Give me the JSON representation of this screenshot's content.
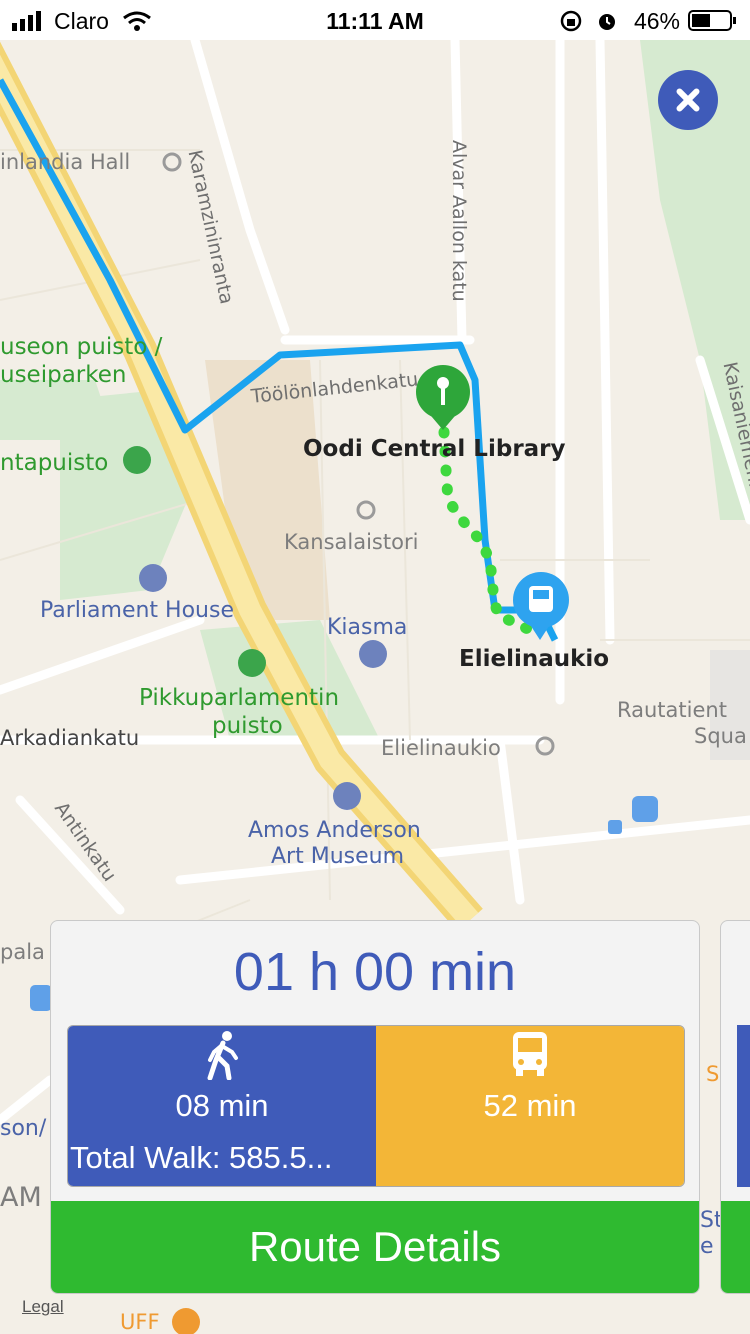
{
  "status_bar": {
    "carrier": "Claro",
    "time": "11:11 AM",
    "battery": "46%"
  },
  "map": {
    "labels": {
      "finlandia_hall": "inlandia Hall",
      "karamzininranta": "Karamzininranta",
      "alvar_aallon_katu": "Alvar Aallon katu",
      "toolonlahdenkatu": "Töölönlahdenkatu",
      "kaisaniemenkatu": "Kaisaniemenk",
      "museon_puisto": "useon puisto /",
      "museiparken": "useiparken",
      "tantapuisto": "ntapuisto",
      "oodi": "Oodi Central Library",
      "kansalaistori": "Kansalaistori",
      "parliament": "Parliament House",
      "kiasma": "Kiasma",
      "elielinaukio_stop": "Elielinaukio",
      "pikkuparlamentin": "Pikkuparlamentin",
      "puisto": "puisto",
      "arkadiankatu": "Arkadiankatu",
      "elielinaukio_square": "Elielinaukio",
      "rautatientori_1": "Rautatient",
      "rautatientori_2": "Squa",
      "antinkatu": "Antinkatu",
      "amos_1": "Amos Anderson",
      "amos_2": "Art Museum",
      "pala": "pala",
      "son": "son/",
      "am": "AM",
      "uff": "UFF",
      "s_label": "S",
      "st": "St",
      "e": "e"
    },
    "legal": "Legal",
    "icons": [
      "close-icon",
      "pin-icon",
      "bus-icon",
      "museum-icon",
      "park-icon",
      "place-icon"
    ]
  },
  "route_card": {
    "duration": "01 h 00 min",
    "walk_minutes": "08 min",
    "total_walk": "Total Walk: 585.5...",
    "bus_minutes": "52 min",
    "details_label": "Route Details"
  },
  "colors": {
    "accent_blue": "#3f5bb9",
    "bus_yellow": "#f3b637",
    "button_green": "#2fba30",
    "route_blue": "#1aa3ef",
    "walk_path_green": "#3ed83e"
  }
}
